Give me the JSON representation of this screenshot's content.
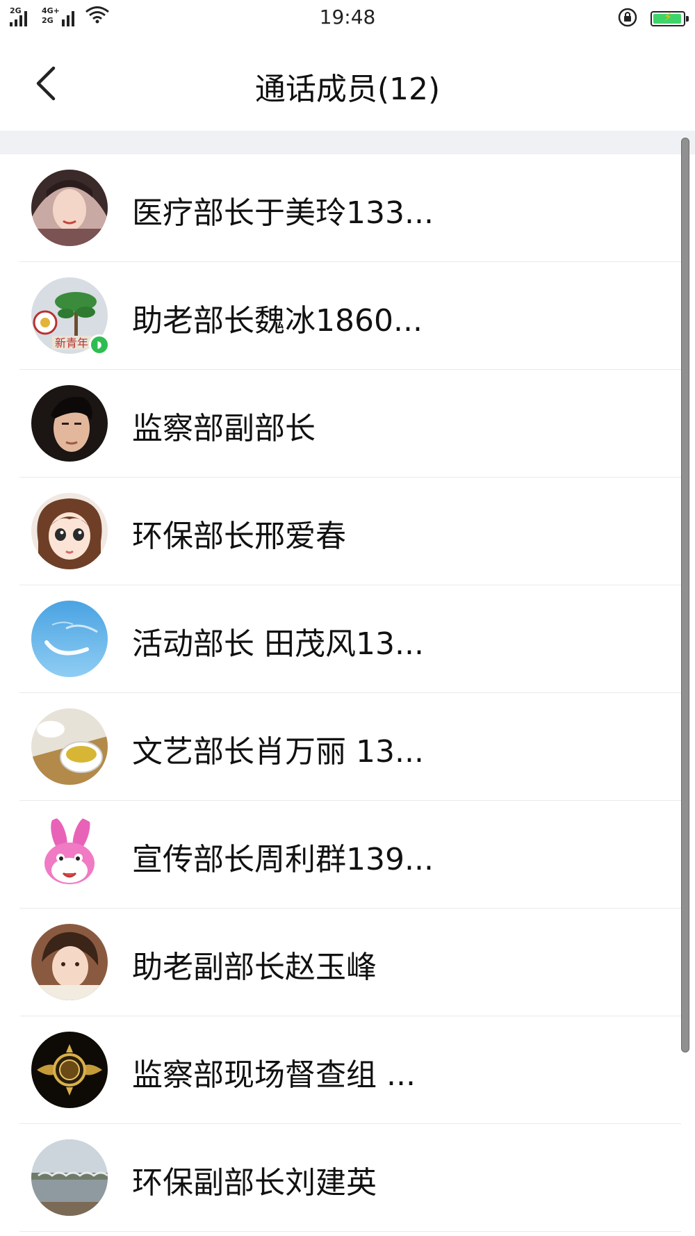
{
  "status_bar": {
    "net1": "2G",
    "net2": "4G+",
    "net3": "2G",
    "time": "19:48",
    "icons": [
      "signal-icon",
      "wifi-icon",
      "rotation-lock-icon",
      "battery-charging-icon"
    ],
    "battery_color": "#3fd46a"
  },
  "header": {
    "title": "通话成员(12)",
    "back_icon": "chevron-left-icon"
  },
  "members": [
    {
      "name": "医疗部长于美玲133...",
      "avatar": "photo-woman"
    },
    {
      "name": "助老部长魏冰1860...",
      "avatar": "tree-logo",
      "badge": "speaking-icon"
    },
    {
      "name": "监察部副部长",
      "avatar": "photo-man"
    },
    {
      "name": "环保部长邢爱春",
      "avatar": "cartoon-girl"
    },
    {
      "name": "活动部长 田茂风13...",
      "avatar": "sky-clouds"
    },
    {
      "name": "文艺部长肖万丽 13...",
      "avatar": "tea-cup"
    },
    {
      "name": "宣传部长周利群139...",
      "avatar": "pink-rabbit"
    },
    {
      "name": "助老副部长赵玉峰",
      "avatar": "photo-child"
    },
    {
      "name": "监察部现场督查组 ...",
      "avatar": "gold-emblem"
    },
    {
      "name": "环保副部长刘建英",
      "avatar": "bridge-lake"
    }
  ],
  "colors": {
    "accent_green": "#2ebd52",
    "band_gray": "#f0f1f5"
  }
}
